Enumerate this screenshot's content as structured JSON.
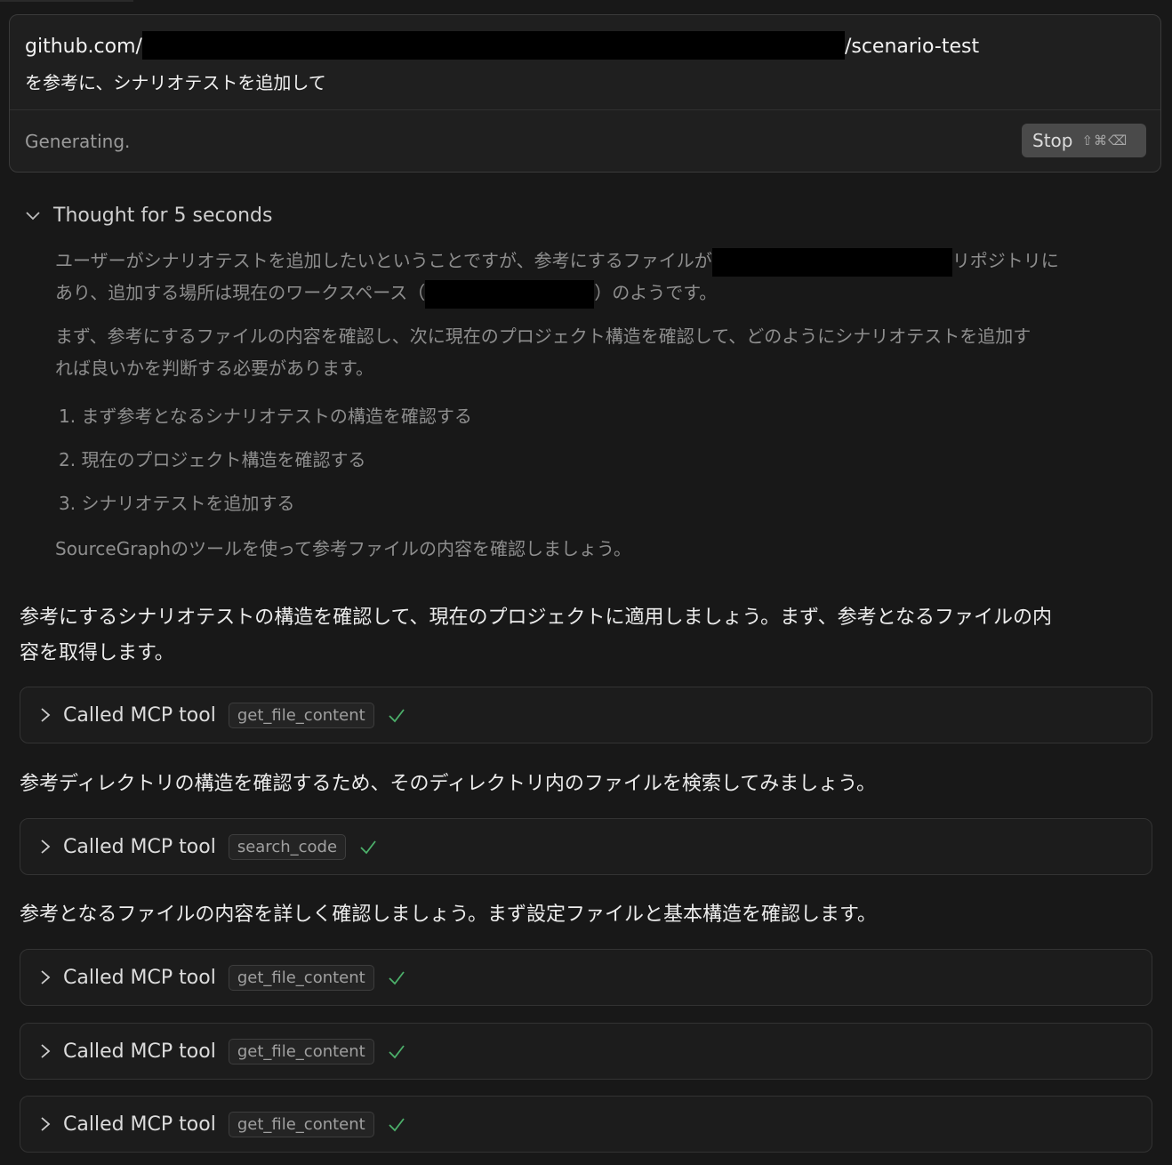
{
  "prompt": {
    "line1_prefix": "github.com/",
    "line1_suffix": "/scenario-test",
    "line2": "を参考に、シナリオテストを追加して",
    "status": "Generating.",
    "stop_label": "Stop",
    "stop_shortcut": "⇧⌘⌫"
  },
  "thought": {
    "title": "Thought for 5 seconds",
    "p1_a": "ユーザーがシナリオテストを追加したいということですが、参考にするファイルが",
    "p1_b": "リポジトリに",
    "p2_a": "あり、追加する場所は現在のワークスペース（",
    "p2_b": "）のようです。",
    "p3_a": "まず、参考にするファイルの内容を確認し、次に現在のプロジェクト構造を確認して、どのようにシナリオテストを追加す",
    "p3_b": "れば良いかを判断する必要があります。",
    "list": [
      "1. まず参考となるシナリオテストの構造を確認する",
      "2. 現在のプロジェクト構造を確認する",
      "3. シナリオテストを追加する"
    ],
    "p4": "SourceGraphのツールを使って参考ファイルの内容を確認しましょう。"
  },
  "messages": {
    "m1_a": "参考にするシナリオテストの構造を確認して、現在のプロジェクトに適用しましょう。まず、参考となるファイルの内",
    "m1_b": "容を取得します。",
    "m2": "参考ディレクトリの構造を確認するため、そのディレクトリ内のファイルを検索してみましょう。",
    "m3": "参考となるファイルの内容を詳しく確認しましょう。まず設定ファイルと基本構造を確認します。"
  },
  "tools": [
    {
      "label": "Called MCP tool",
      "name": "get_file_content"
    },
    {
      "label": "Called MCP tool",
      "name": "search_code"
    },
    {
      "label": "Called MCP tool",
      "name": "get_file_content"
    },
    {
      "label": "Called MCP tool",
      "name": "get_file_content"
    },
    {
      "label": "Called MCP tool",
      "name": "get_file_content"
    }
  ],
  "colors": {
    "background": "#181818",
    "check": "#4caf6a",
    "redaction": "#000000"
  },
  "icons": {
    "thought_toggle": "chevron-down-icon",
    "tool_toggle": "chevron-right-icon",
    "tool_status": "check-icon"
  }
}
